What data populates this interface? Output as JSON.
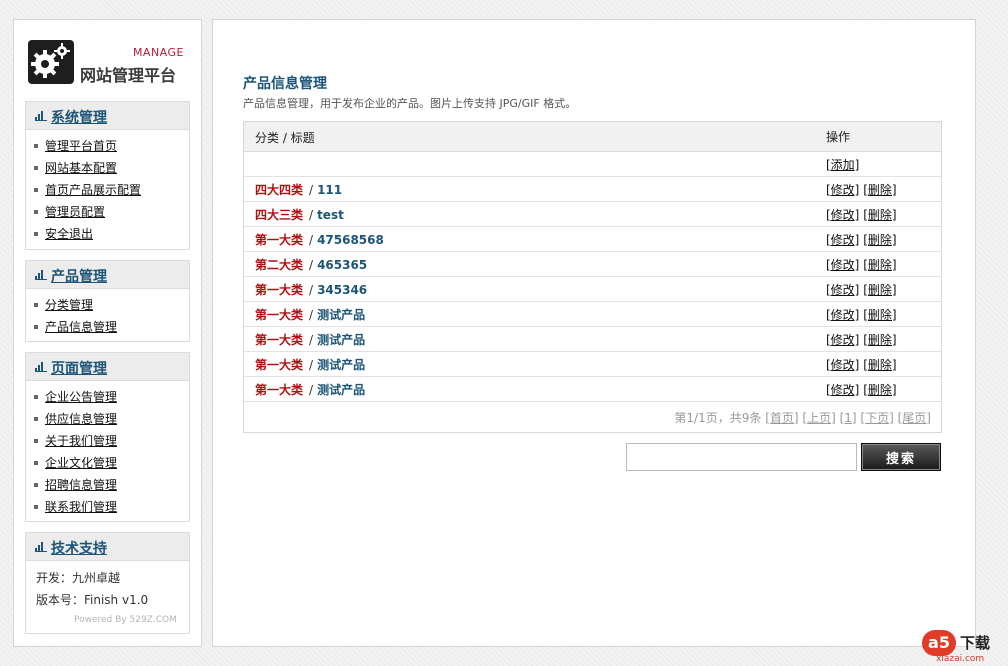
{
  "logo": {
    "en": "MANAGE",
    "cn": "网站管理平台"
  },
  "sidebar": {
    "sections": [
      {
        "title": "系统管理",
        "items": [
          "管理平台首页",
          "网站基本配置",
          "首页产品展示配置",
          "管理员配置",
          "安全退出"
        ]
      },
      {
        "title": "产品管理",
        "items": [
          "分类管理",
          "产品信息管理"
        ]
      },
      {
        "title": "页面管理",
        "items": [
          "企业公告管理",
          "供应信息管理",
          "关于我们管理",
          "企业文化管理",
          "招聘信息管理",
          "联系我们管理"
        ]
      },
      {
        "title": "技术支持",
        "info": [
          "开发：九州卓越",
          "版本号：Finish v1.0"
        ],
        "powered": "Powered By 529Z.COM"
      }
    ]
  },
  "main": {
    "title": "产品信息管理",
    "description": "产品信息管理，用于发布企业的产品。图片上传支持 JPG/GIF 格式。",
    "table": {
      "header_col1": "分类 / 标题",
      "header_col2": "操作",
      "add_label": "[添加]",
      "edit_label": "[修改]",
      "delete_label": "[删除]",
      "rows": [
        {
          "category": "四大四类",
          "title": "111"
        },
        {
          "category": "四大三类",
          "title": "test"
        },
        {
          "category": "第一大类",
          "title": "47568568"
        },
        {
          "category": "第二大类",
          "title": "465365"
        },
        {
          "category": "第一大类",
          "title": "345346"
        },
        {
          "category": "第一大类",
          "title": "测试产品"
        },
        {
          "category": "第一大类",
          "title": "测试产品"
        },
        {
          "category": "第一大类",
          "title": "测试产品"
        },
        {
          "category": "第一大类",
          "title": "测试产品"
        }
      ],
      "pager": {
        "summary": "第1/1页，共9条",
        "first": "[首页]",
        "prev": "[上页]",
        "page": "[1]",
        "next": "[下页]",
        "last": "[尾页]"
      }
    },
    "search": {
      "value": "",
      "button": "搜索"
    }
  },
  "watermark": {
    "badge": "a5",
    "cn": "下载",
    "url": "xiazai.com"
  }
}
